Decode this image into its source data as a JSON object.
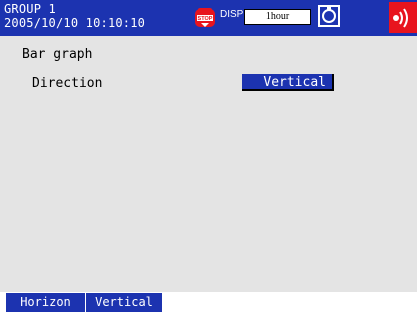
{
  "header": {
    "group_name": "GROUP 1",
    "datetime": "2005/10/10 10:10:10",
    "stop_icon_text": "STOP",
    "disp_label": "DISP",
    "interval": "1hour"
  },
  "menu": {
    "title": "Bar graph",
    "direction_label": "Direction",
    "direction_value": "Vertical"
  },
  "softkeys": [
    {
      "label": "Horizon"
    },
    {
      "label": "Vertical"
    }
  ],
  "colors": {
    "accent": "#1c33b0",
    "background": "#e4e4e4",
    "alarm": "#e8141e"
  },
  "icons": {
    "status": "stop-icon",
    "media": "media-icon",
    "alarm": "alarm-icon"
  }
}
